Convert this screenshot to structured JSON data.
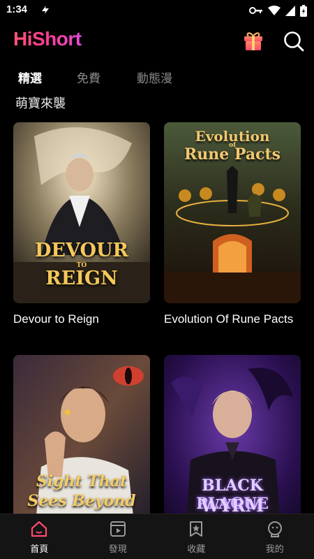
{
  "status_bar": {
    "time": "1:34",
    "left_icon": "sync-icon",
    "right_icons": [
      "key-icon",
      "wifi-icon",
      "signal-icon",
      "battery-icon"
    ]
  },
  "header": {
    "logo": "HiShort",
    "gift_icon": "gift-icon",
    "search_icon": "search-icon",
    "brand_color": "#ff3c90"
  },
  "tabs": [
    {
      "label": "精選",
      "active": true
    },
    {
      "label": "免費",
      "active": false
    },
    {
      "label": "動態漫",
      "active": false
    }
  ],
  "section": {
    "title": "萌寶來襲"
  },
  "cards": [
    {
      "title": "Devour to Reign",
      "cover_text": [
        "DEVOUR",
        "TO",
        "REIGN"
      ]
    },
    {
      "title": "Evolution Of Rune Pacts",
      "cover_text": [
        "Evolution",
        "of",
        "Rune Pacts"
      ]
    },
    {
      "title": "",
      "cover_text": [
        "Sight That",
        "Sees Beyond"
      ]
    },
    {
      "title": "",
      "cover_text": [
        "BLACK PLAGUE",
        "WYRM"
      ]
    }
  ],
  "bottom_nav": [
    {
      "label": "首頁",
      "icon": "home-icon",
      "active": true
    },
    {
      "label": "發現",
      "icon": "play-icon",
      "active": false
    },
    {
      "label": "收藏",
      "icon": "bookmark-icon",
      "active": false
    },
    {
      "label": "我的",
      "icon": "profile-icon",
      "active": false
    }
  ]
}
